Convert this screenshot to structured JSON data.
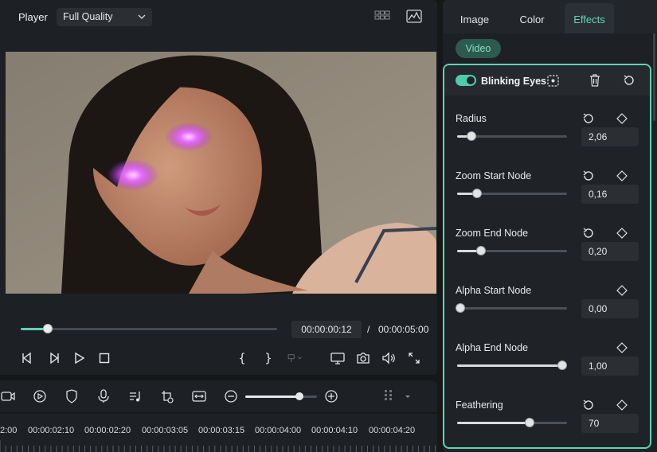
{
  "player": {
    "label": "Player",
    "quality": "Full Quality",
    "progress": 0.105,
    "current_time": "00:00:00:12",
    "separator": "/",
    "total_time": "00:00:05:00",
    "icons": [
      "grid-view-icon",
      "scope-icon"
    ],
    "controls": [
      "previous-frame-icon",
      "next-frame-icon",
      "play-icon",
      "stop-icon",
      "mark-in-icon",
      "mark-out-icon",
      "insert-marker-icon",
      "display-icon",
      "snapshot-icon",
      "volume-icon",
      "fullscreen-icon"
    ],
    "mark_in": "{",
    "mark_out": "}"
  },
  "timeline": {
    "zoom_level": 0.76,
    "ruler": [
      "2:00",
      "00:00:02:10",
      "00:00:02:20",
      "00:00:03:05",
      "00:00:03:15",
      "00:00:04:00",
      "00:00:04:10",
      "00:00:04:20"
    ],
    "toolbar_icons": [
      "add-media-icon",
      "speed-icon",
      "mask-shield-icon",
      "microphone-icon",
      "audio-list-icon",
      "auto-reframe-icon",
      "crop-icon",
      "zoom-out-icon",
      "zoom-in-icon",
      "grid-icon",
      "dropdown-icon"
    ]
  },
  "panel": {
    "tabs": [
      {
        "label": "Image",
        "active": false
      },
      {
        "label": "Color",
        "active": false
      },
      {
        "label": "Effects",
        "active": true
      }
    ],
    "chip": "Video",
    "effect": {
      "name": "Blinking Eyes",
      "enabled": true,
      "params": [
        {
          "label": "Radius",
          "value": "2,06",
          "fraction": 0.13,
          "reset": true
        },
        {
          "label": "Zoom Start Node",
          "value": "0,16",
          "fraction": 0.18,
          "reset": true
        },
        {
          "label": "Zoom End Node",
          "value": "0,20",
          "fraction": 0.22,
          "reset": true
        },
        {
          "label": "Alpha Start Node",
          "value": "0,00",
          "fraction": 0.03,
          "reset": false
        },
        {
          "label": "Alpha End Node",
          "value": "1,00",
          "fraction": 0.96,
          "reset": false
        },
        {
          "label": "Feathering",
          "value": "70",
          "fraction": 0.66,
          "reset": true
        }
      ]
    }
  },
  "colors": {
    "accent": "#5cd6b4",
    "background": "#151719",
    "panel": "#1d2024",
    "glow": "#e05cff"
  }
}
